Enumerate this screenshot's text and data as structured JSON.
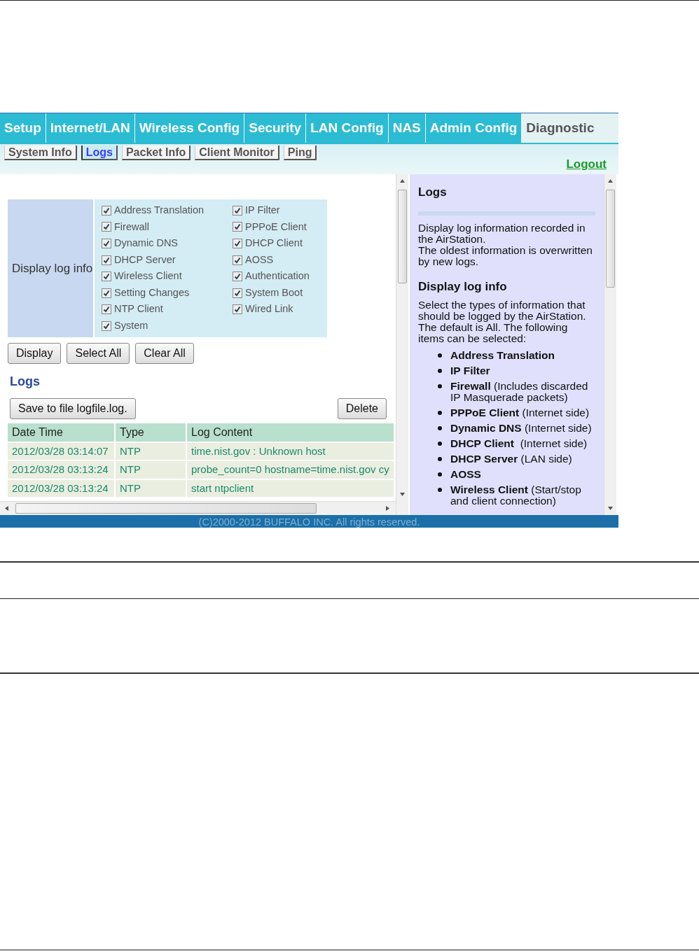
{
  "main_tabs": [
    {
      "label": "Setup",
      "selected": false
    },
    {
      "label": "Internet/LAN",
      "selected": false
    },
    {
      "label": "Wireless Config",
      "selected": false
    },
    {
      "label": "Security",
      "selected": false
    },
    {
      "label": "LAN Config",
      "selected": false
    },
    {
      "label": "NAS",
      "selected": false
    },
    {
      "label": "Admin Config",
      "selected": false
    },
    {
      "label": "Diagnostic",
      "selected": true
    }
  ],
  "sub_tabs": [
    {
      "label": "System Info",
      "selected": false
    },
    {
      "label": "Logs",
      "selected": true
    },
    {
      "label": "Packet Info",
      "selected": false
    },
    {
      "label": "Client Monitor",
      "selected": false
    },
    {
      "label": "Ping",
      "selected": false
    }
  ],
  "logout": "Logout",
  "display_log_info": {
    "label": "Display log info",
    "columns": [
      [
        {
          "label": "Address Translation",
          "checked": true
        },
        {
          "label": "Firewall",
          "checked": true
        },
        {
          "label": "Dynamic DNS",
          "checked": true
        },
        {
          "label": "DHCP Server",
          "checked": true
        },
        {
          "label": "Wireless Client",
          "checked": true
        },
        {
          "label": "Setting Changes",
          "checked": true
        },
        {
          "label": "NTP Client",
          "checked": true
        },
        {
          "label": "System",
          "checked": true
        }
      ],
      [
        {
          "label": "IP Filter",
          "checked": true
        },
        {
          "label": "PPPoE Client",
          "checked": true
        },
        {
          "label": "DHCP Client",
          "checked": true
        },
        {
          "label": "AOSS",
          "checked": true
        },
        {
          "label": "Authentication",
          "checked": true
        },
        {
          "label": "System Boot",
          "checked": true
        },
        {
          "label": "Wired Link",
          "checked": true
        }
      ]
    ]
  },
  "buttons": [
    "Display",
    "Select All",
    "Clear All"
  ],
  "logs_heading": "Logs",
  "save_button": "Save to file logfile.log.",
  "delete_button": "Delete",
  "table": {
    "columns": [
      "Date Time",
      "Type",
      "Log Content"
    ],
    "rows": [
      [
        "2012/03/28 03:14:07",
        "NTP",
        "time.nist.gov : Unknown host"
      ],
      [
        "2012/03/28 03:13:24",
        "NTP",
        "probe_count=0 hostname=time.nist.gov cy"
      ],
      [
        "2012/03/28 03:13:24",
        "NTP",
        "start ntpclient"
      ]
    ]
  },
  "help": {
    "title": "Logs",
    "paragraphs": [
      "Display log information recorded in the AirStation.",
      "The oldest information is overwritten by new logs."
    ],
    "section_title": "Display log info",
    "section_text": "Select the types of information that should be logged by the AirStation. The default is All. The following items can be selected:",
    "items": [
      "**Address Translation**",
      "**IP Filter**",
      "**Firewall** (Includes discarded IP Masquerade packets)",
      "**PPPoE Client** (Internet side)",
      "**Dynamic DNS** (Internet side)",
      "**DHCP Client**  (Internet side)",
      "**DHCP Server** (LAN side)",
      "**AOSS**",
      "**Wireless Client** (Start/stop and client connection)"
    ]
  },
  "footer": "(C)2000-2012 BUFFALO INC. All rights reserved."
}
